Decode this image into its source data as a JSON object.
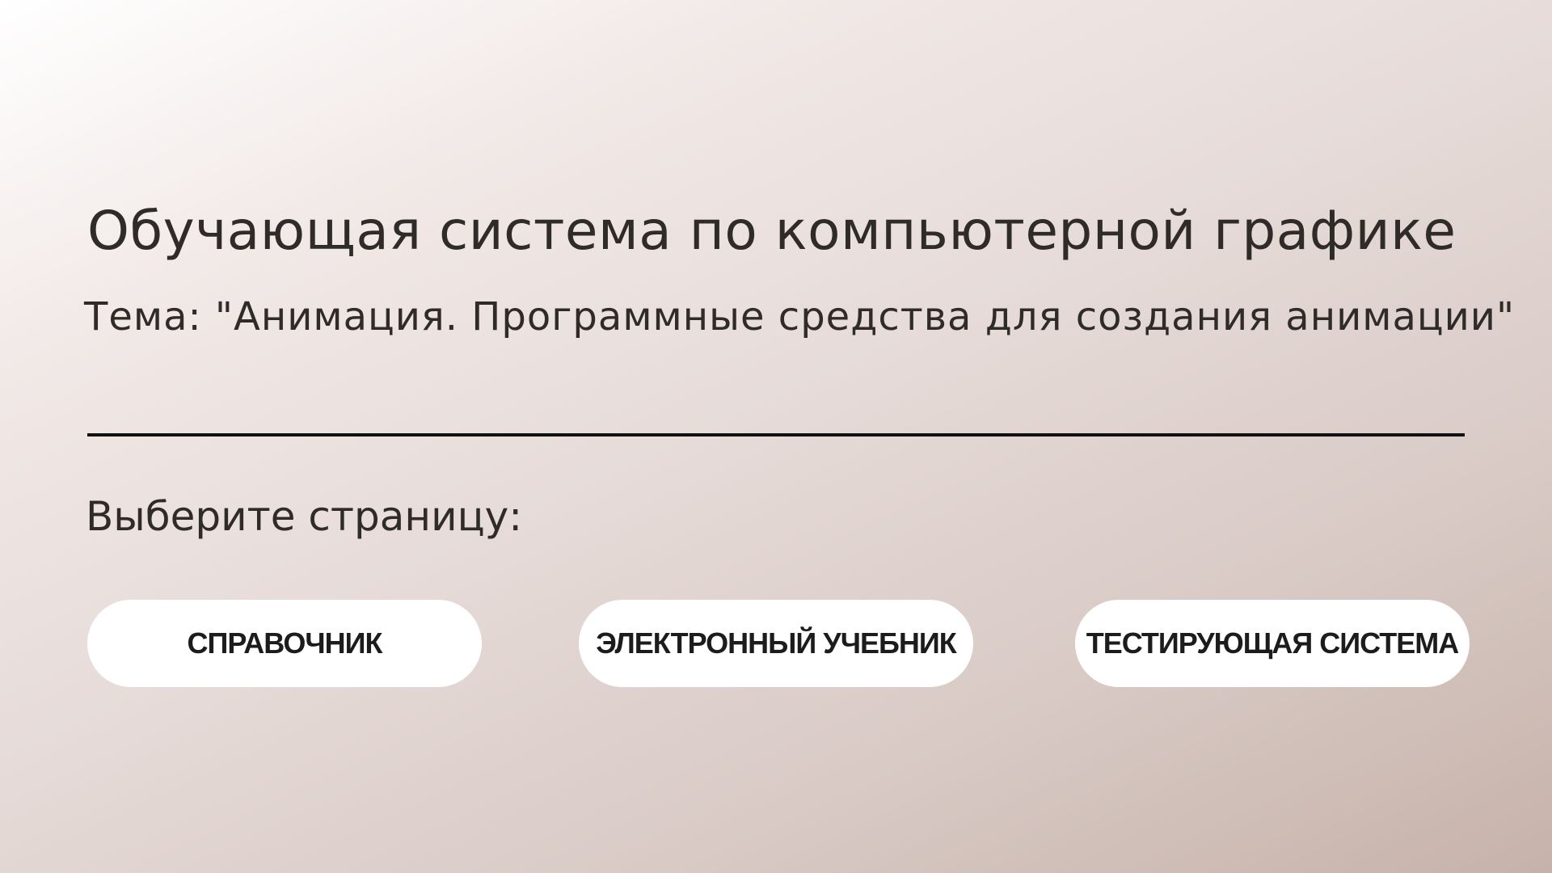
{
  "header": {
    "title": "Обучающая система по компьютерной графике",
    "subtitle": "Тема: \"Анимация. Программные средства для создания анимации\""
  },
  "main": {
    "prompt": "Выберите страницу:",
    "buttons": [
      {
        "label": "СПРАВОЧНИК"
      },
      {
        "label": "ЭЛЕКТРОННЫЙ УЧЕБНИК"
      },
      {
        "label": "ТЕСТИРУЮЩАЯ СИСТЕМА"
      }
    ]
  },
  "colors": {
    "text": "#2f2b29",
    "button_bg": "#ffffff",
    "button_text": "#1c1c1c",
    "divider": "#111111",
    "gradient_start": "#ffffff",
    "gradient_end": "#c6b2aa"
  }
}
